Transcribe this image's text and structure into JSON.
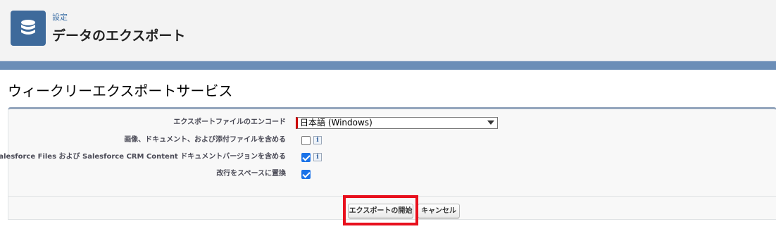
{
  "header": {
    "breadcrumb": "設定",
    "title": "データのエクスポート",
    "icon": "database-icon",
    "icon_color": "#3e6a9b"
  },
  "section": {
    "title": "ウィークリーエクスポートサービス"
  },
  "form": {
    "encoding": {
      "label": "エクスポートファイルのエンコード",
      "value": "日本語 (Windows)"
    },
    "include_images": {
      "label": "画像、ドキュメント、および添付ファイルを含める",
      "checked": false
    },
    "include_files": {
      "label": "Salesforce Files および Salesforce CRM Content ドキュメントバージョンを含める",
      "checked": true
    },
    "replace_newlines": {
      "label": "改行をスペースに置換",
      "checked": true
    },
    "info_glyph": "i"
  },
  "buttons": {
    "start_export": "エクスポートの開始",
    "cancel": "キャンセル"
  },
  "colors": {
    "highlight": "#e8101d",
    "checkbox_checked": "#1b73e8",
    "required_marker": "#cc0000"
  }
}
